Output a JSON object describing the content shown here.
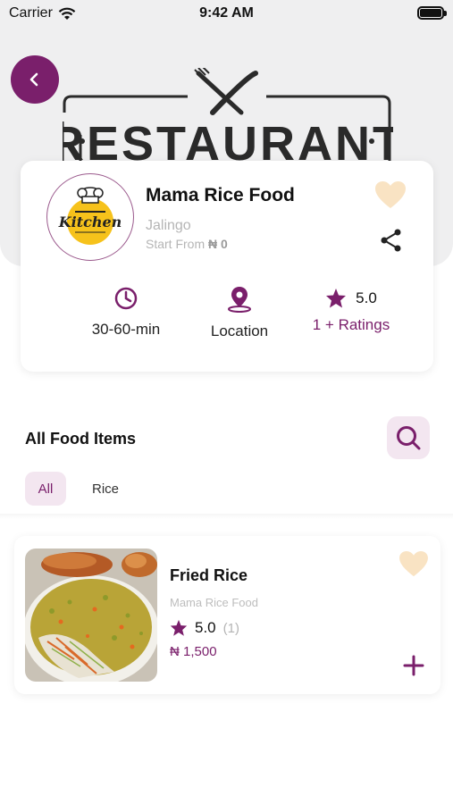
{
  "status_bar": {
    "carrier": "Carrier",
    "time": "9:42 AM"
  },
  "hero": {
    "banner_text": "RESTAURANT"
  },
  "restaurant": {
    "name": "Mama Rice Food",
    "city": "Jalingo",
    "start_from_label": "Start From",
    "start_from_price": "₦ 0",
    "logo_text": "Kitchen",
    "stats": {
      "time": "30-60-min",
      "location": "Location",
      "rating": "5.0",
      "ratings_label": "1 + Ratings"
    }
  },
  "food_section": {
    "title": "All Food Items",
    "filters": [
      "All",
      "Rice"
    ]
  },
  "food_items": [
    {
      "name": "Fried Rice",
      "restaurant": "Mama Rice Food",
      "rating": "5.0",
      "rating_count": "(1)",
      "price": "₦ 1,500"
    }
  ],
  "colors": {
    "primary": "#7a1f6b",
    "chip_bg": "#f3e6f0",
    "favorite": "#f9e3c3",
    "hero_bg": "#efeff0"
  },
  "icons": {
    "back": "chevron-left-icon",
    "favorite": "heart-icon",
    "share": "share-icon",
    "time": "clock-icon",
    "location": "map-pin-icon",
    "rating": "star-icon",
    "search": "search-icon",
    "add": "plus-icon"
  }
}
